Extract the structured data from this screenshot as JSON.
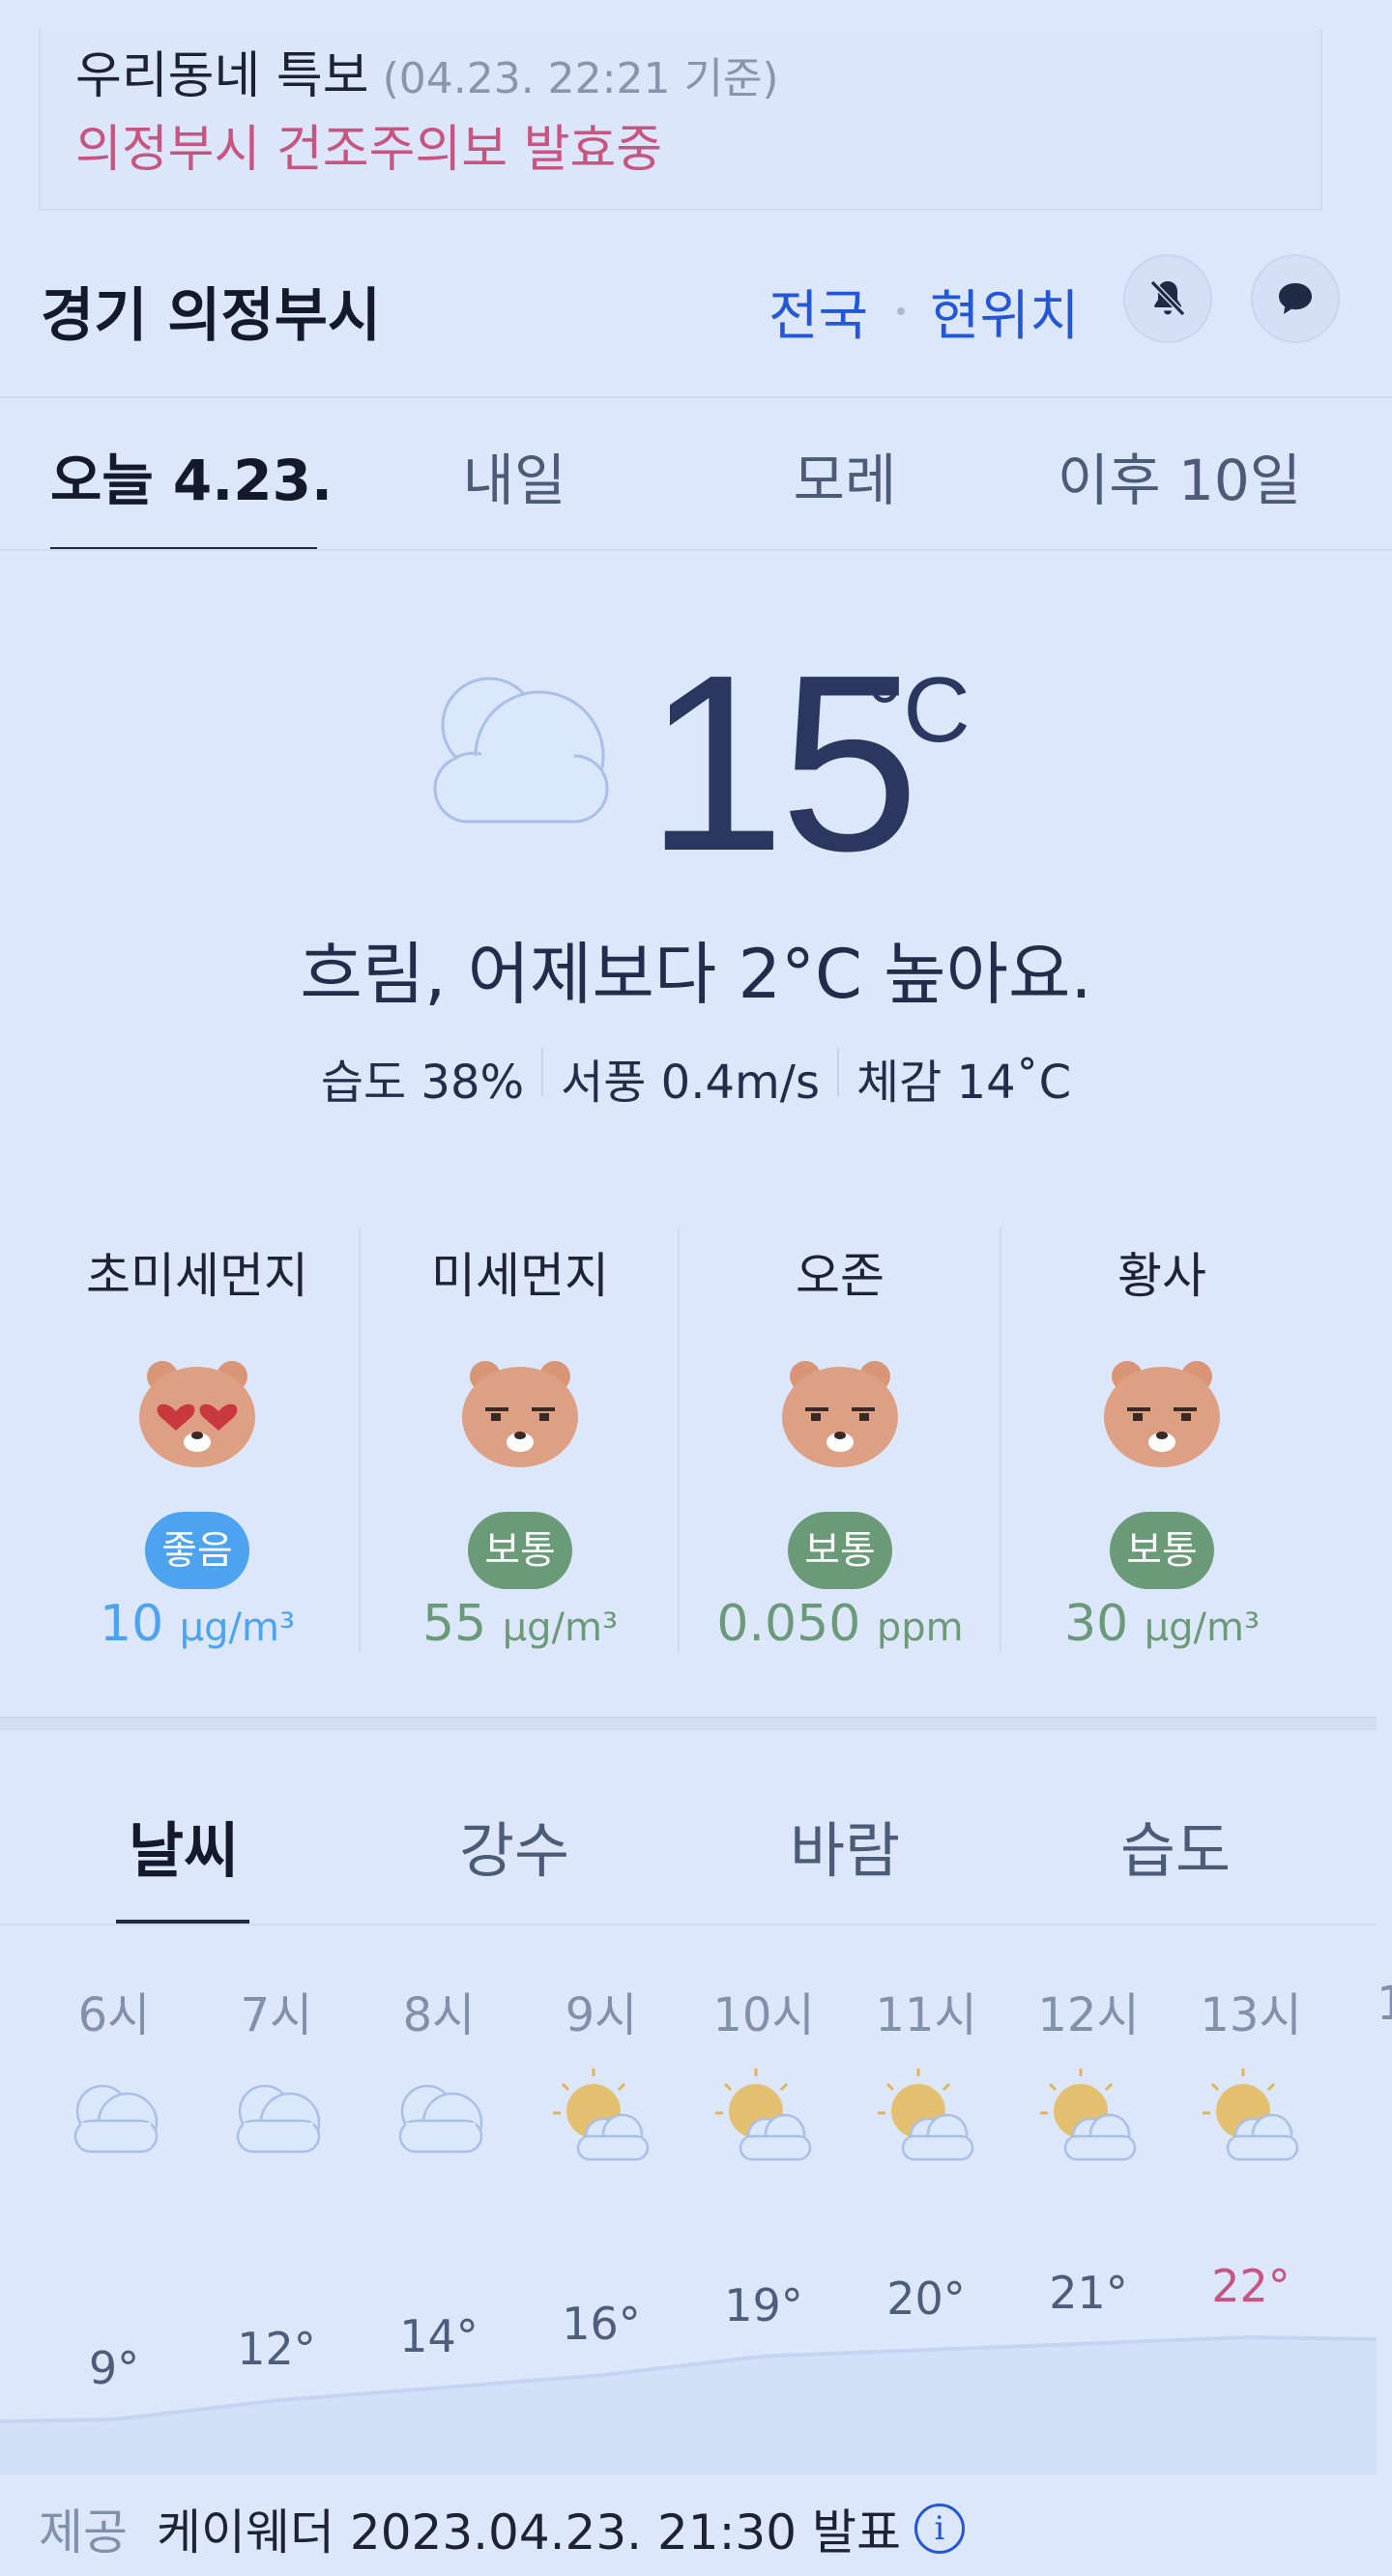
{
  "alert": {
    "title": "우리동네 특보",
    "time": "(04.23. 22:21 기준)",
    "text": "의정부시 건조주의보 발효중"
  },
  "header": {
    "location": "경기 의정부시",
    "nav": [
      "전국",
      "현위치"
    ],
    "icons": [
      "bell-off-icon",
      "chat-icon"
    ],
    "link_color": "#2457d6"
  },
  "day_tabs": [
    "오늘 4.23.",
    "내일",
    "모레",
    "이후 10일"
  ],
  "current": {
    "icon": "cloud-icon",
    "temp": "15",
    "unit": "°C",
    "summary": "흐림, 어제보다 2°C 높아요.",
    "humidity": "습도 38%",
    "wind": "서풍 0.4m/s",
    "feels": "체감 14˚C"
  },
  "air_quality": [
    {
      "title": "초미세먼지",
      "badge": "좋음",
      "value": "10",
      "unit": "μg/m³",
      "color": "#4da3f0",
      "face": "heart-eyes"
    },
    {
      "title": "미세먼지",
      "badge": "보통",
      "value": "55",
      "unit": "μg/m³",
      "color": "#6b9a78",
      "face": "neutral"
    },
    {
      "title": "오존",
      "badge": "보통",
      "value": "0.050",
      "unit": "ppm",
      "color": "#6b9a78",
      "face": "neutral"
    },
    {
      "title": "황사",
      "badge": "보통",
      "value": "30",
      "unit": "μg/m³",
      "color": "#6b9a78",
      "face": "neutral"
    }
  ],
  "forecast_tabs": [
    "날씨",
    "강수",
    "바람",
    "습도"
  ],
  "hourly": [
    {
      "time": "6시",
      "icon": "cloud-icon",
      "temp": "9°",
      "value": 9
    },
    {
      "time": "7시",
      "icon": "cloud-icon",
      "temp": "12°",
      "value": 12
    },
    {
      "time": "8시",
      "icon": "cloud-icon",
      "temp": "14°",
      "value": 14
    },
    {
      "time": "9시",
      "icon": "partly-sunny-icon",
      "temp": "16°",
      "value": 16
    },
    {
      "time": "10시",
      "icon": "partly-sunny-icon",
      "temp": "19°",
      "value": 19
    },
    {
      "time": "11시",
      "icon": "partly-sunny-icon",
      "temp": "20°",
      "value": 20
    },
    {
      "time": "12시",
      "icon": "partly-sunny-icon",
      "temp": "21°",
      "value": 21
    },
    {
      "time": "13시",
      "icon": "partly-sunny-icon",
      "temp": "22°",
      "value": 22,
      "highlight": true
    }
  ],
  "footer": {
    "label": "제공",
    "text": "케이웨더 2023.04.23. 21:30 발표",
    "info": "i"
  }
}
